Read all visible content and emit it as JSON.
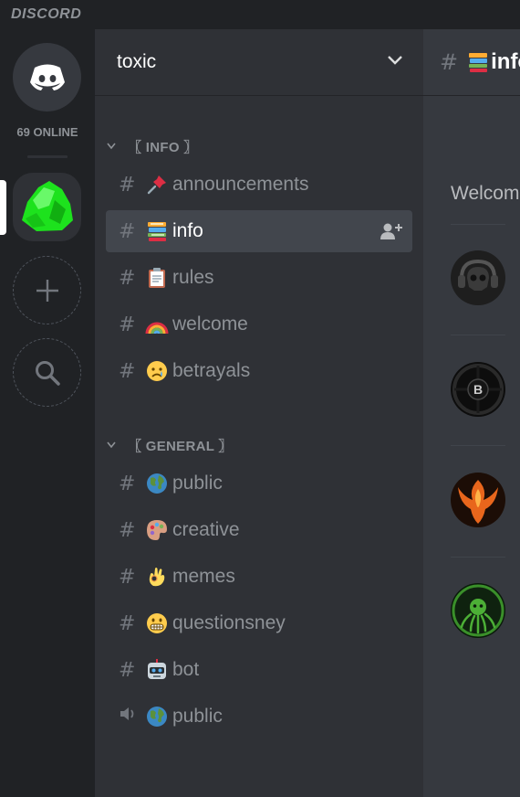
{
  "app": {
    "wordmark": "DISCORD"
  },
  "guilds": {
    "online_text": "69 ONLINE",
    "add_server_icon": "plus-icon",
    "explore_icon": "search-icon"
  },
  "server": {
    "name": "toxic",
    "categories": [
      {
        "name": "〖 INFO 〗",
        "channels": [
          {
            "label": "announcements",
            "emoji": "pushpin",
            "type": "text"
          },
          {
            "label": "info",
            "emoji": "books",
            "type": "text",
            "active": true
          },
          {
            "label": "rules",
            "emoji": "clipboard",
            "type": "text"
          },
          {
            "label": "welcome",
            "emoji": "rainbow",
            "type": "text"
          },
          {
            "label": "betrayals",
            "emoji": "sad-face",
            "type": "text"
          }
        ]
      },
      {
        "name": "〖 GENERAL 〗",
        "channels": [
          {
            "label": "public",
            "emoji": "globe",
            "type": "text"
          },
          {
            "label": "creative",
            "emoji": "palette",
            "type": "text"
          },
          {
            "label": "memes",
            "emoji": "ok-hand",
            "type": "text"
          },
          {
            "label": "questionsney",
            "emoji": "grimacing-face",
            "type": "text"
          },
          {
            "label": "bot",
            "emoji": "robot",
            "type": "text"
          },
          {
            "label": "public",
            "emoji": "globe",
            "type": "voice"
          }
        ]
      }
    ]
  },
  "chat": {
    "channel_title": "info",
    "welcome_text": "Welcom"
  },
  "colors": {
    "background": "#202225",
    "sidebar": "#2f3136",
    "chat": "#36393f",
    "active_channel": "#42464d",
    "muted_text": "#8e9297"
  }
}
